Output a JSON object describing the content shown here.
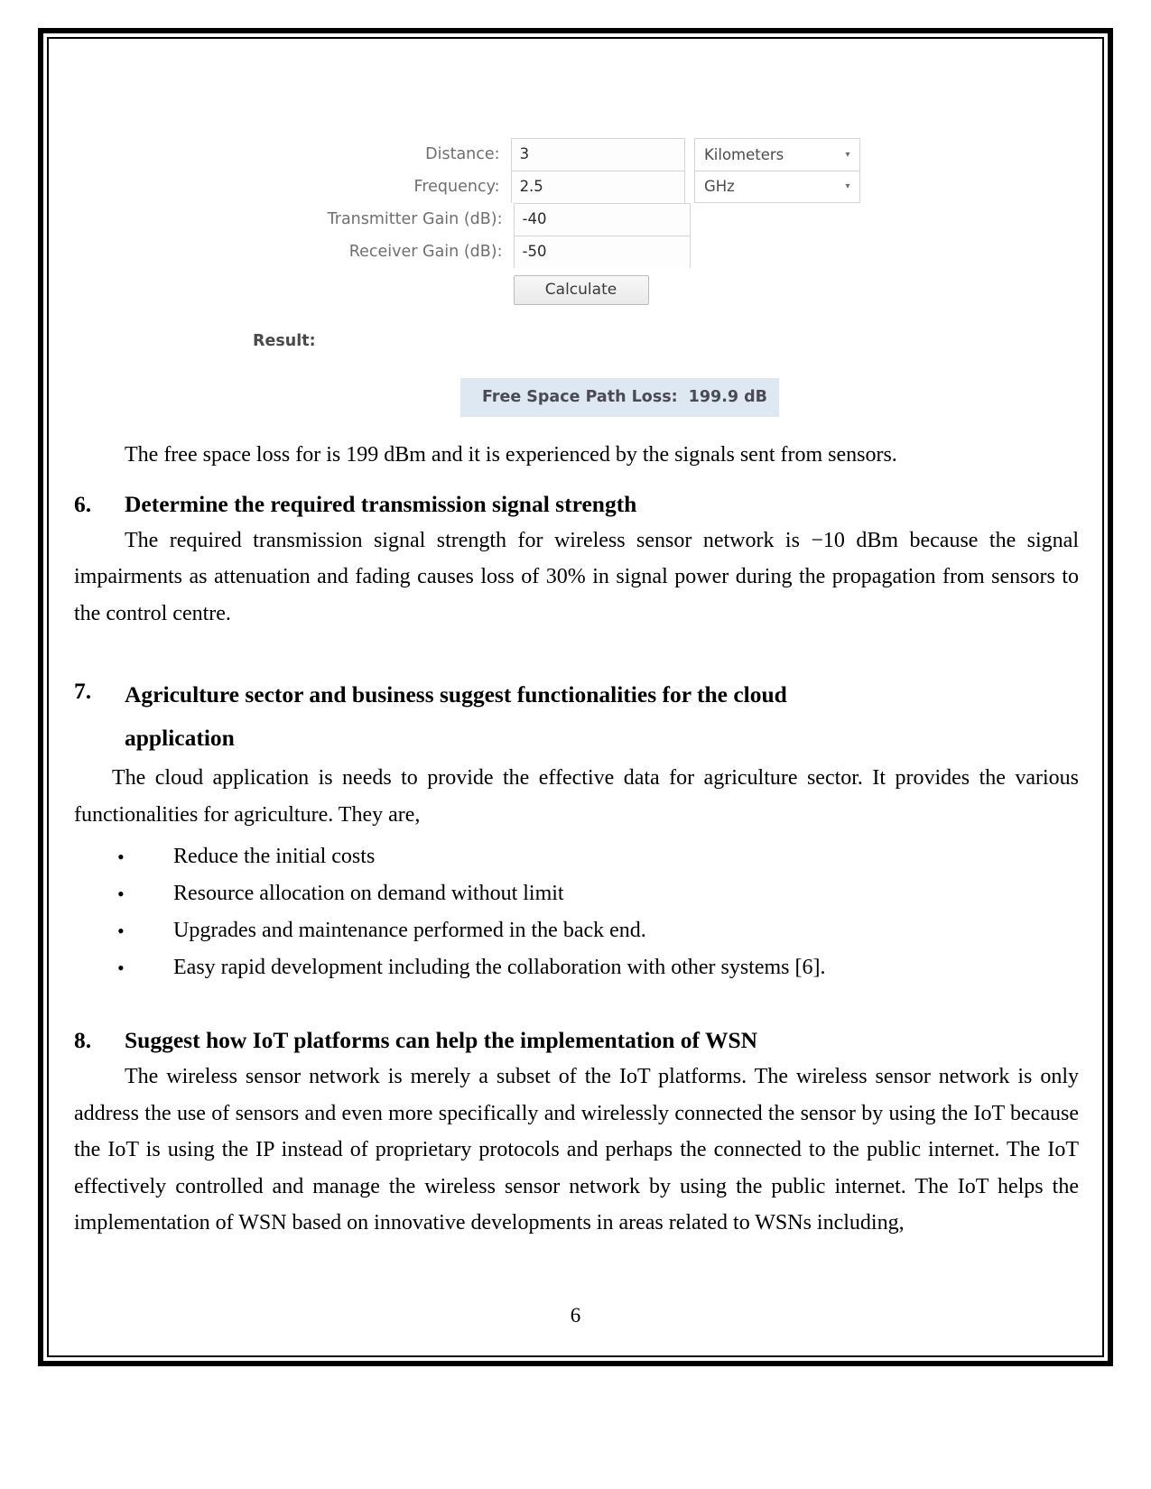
{
  "document": {
    "page_number": "6"
  },
  "calculator": {
    "fields": [
      {
        "label": "Distance:",
        "value": "3",
        "unit": "Kilometers",
        "has_unit": true
      },
      {
        "label": "Frequency:",
        "value": "2.5",
        "unit": "GHz",
        "has_unit": true
      },
      {
        "label": "Transmitter Gain (dB):",
        "value": "-40",
        "unit": "",
        "has_unit": false
      },
      {
        "label": "Receiver Gain (dB):",
        "value": "-50",
        "unit": "",
        "has_unit": false
      }
    ],
    "calculate_button": "Calculate",
    "result_label": "Result:",
    "result": {
      "label": "Free Space Path Loss:",
      "value": "199.9 dB"
    },
    "dropdown_caret": "▾",
    "colors": {
      "result_banner_background": "#dde8f2",
      "label_text": "#6f6f6f",
      "field_border": "#d4d4d4"
    }
  },
  "content": {
    "intro_paragraph": "The free space loss for is 199 dBm and it is experienced by the signals sent from sensors.",
    "section6": {
      "number": "6.",
      "title": "Determine the required transmission signal strength",
      "paragraph": "The required transmission signal strength for wireless sensor network is −10 dBm because the signal impairments as attenuation and fading causes loss of 30% in signal power during the propagation from sensors to the control centre."
    },
    "section7": {
      "number": "7.",
      "title_line1": "Agriculture sector and business suggest functionalities for the cloud",
      "title_line2": "application",
      "paragraph": "The cloud application is needs to provide the effective data for agriculture sector. It provides the various functionalities for agriculture. They are,",
      "bullet_glyph": "•",
      "bullets": [
        "Reduce the initial costs",
        "Resource allocation on demand without limit",
        "Upgrades and maintenance performed in the back end.",
        "Easy rapid development including the collaboration with other systems [6]."
      ]
    },
    "section8": {
      "number": "8.",
      "title": "Suggest how IoT platforms can help the implementation of WSN",
      "paragraph": "The wireless sensor network is merely a subset of the IoT platforms. The wireless sensor network is only address the use of sensors and even more specifically and wirelessly connected the sensor by using the IoT because the IoT is using the IP instead of proprietary protocols and perhaps the connected to the public internet. The IoT effectively controlled and manage the wireless sensor network by using the public internet. The IoT helps the implementation of WSN based on innovative developments in areas related to WSNs including,"
    }
  }
}
